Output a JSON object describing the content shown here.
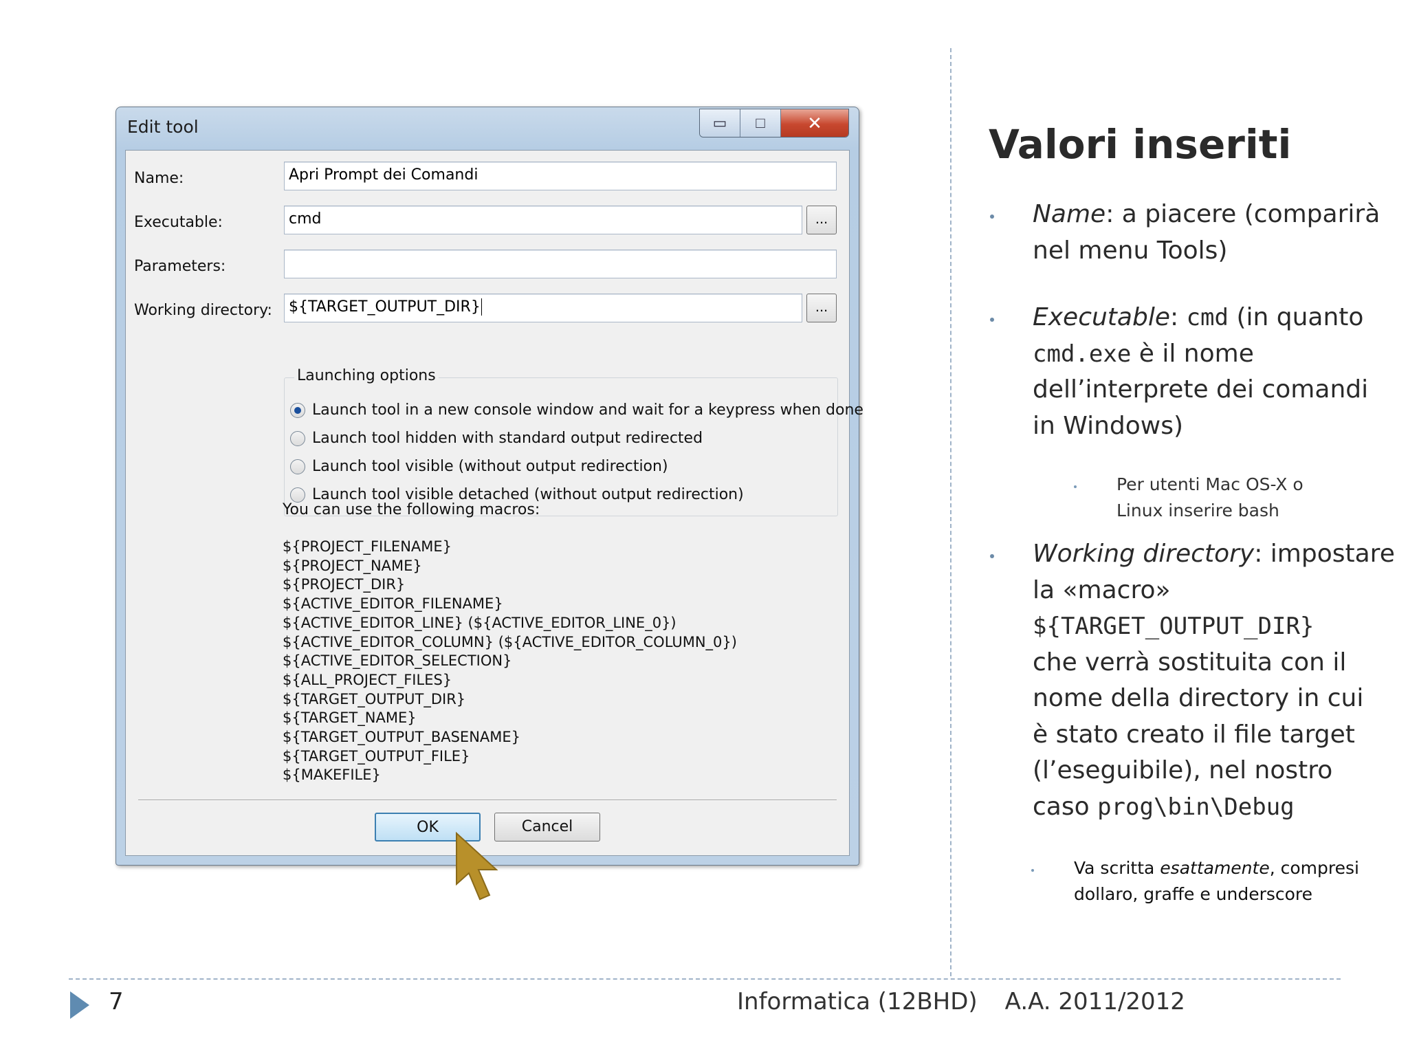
{
  "dialog": {
    "title": "Edit tool",
    "window_buttons": {
      "minimize": "▭",
      "maximize": "□",
      "close": "✕"
    },
    "fields": {
      "name_label": "Name:",
      "name_value": "Apri Prompt dei Comandi",
      "executable_label": "Executable:",
      "executable_value": "cmd",
      "parameters_label": "Parameters:",
      "parameters_value": "",
      "working_dir_label": "Working directory:",
      "working_dir_value": "${TARGET_OUTPUT_DIR}",
      "browse_label": "..."
    },
    "launching_options": {
      "legend": "Launching options",
      "options": [
        "Launch tool in a new console window and wait for a keypress when done",
        "Launch tool hidden with standard output redirected",
        "Launch tool visible (without output redirection)",
        "Launch tool visible detached (without output redirection)"
      ],
      "selected_index": 0
    },
    "macros_heading": "You can use the following macros:",
    "macros": [
      "${PROJECT_FILENAME}",
      "${PROJECT_NAME}",
      "${PROJECT_DIR}",
      "${ACTIVE_EDITOR_FILENAME}",
      "${ACTIVE_EDITOR_LINE} (${ACTIVE_EDITOR_LINE_0})",
      "${ACTIVE_EDITOR_COLUMN} (${ACTIVE_EDITOR_COLUMN_0})",
      "${ACTIVE_EDITOR_SELECTION}",
      "${ALL_PROJECT_FILES}",
      "${TARGET_OUTPUT_DIR}",
      "${TARGET_NAME}",
      "${TARGET_OUTPUT_BASENAME}",
      "${TARGET_OUTPUT_FILE}",
      "${MAKEFILE}"
    ],
    "ok_label": "OK",
    "cancel_label": "Cancel"
  },
  "slide": {
    "heading": "Valori inseriti",
    "bullets": {
      "name_term": "Name",
      "name_line1_rest": ": a piacere (comparirà",
      "name_line2": "nel menu Tools)",
      "exe_term": "Executable",
      "exe_line1_sep": ": ",
      "exe_code1": "cmd",
      "exe_line1_rest": " (in quanto",
      "exe_code2": "cmd.exe",
      "exe_line2_rest": " è il nome",
      "exe_line3": "dell’interprete dei comandi",
      "exe_line4": "in Windows)",
      "wd_term": "Working directory",
      "wd_line1_rest": ": impostare",
      "wd_line2": "la «macro»",
      "wd_code": "${TARGET_OUTPUT_DIR}",
      "wd_line4": "che verrà sostituita con il",
      "wd_line5": "nome della directory in cui",
      "wd_line6": "è stato creato il file target",
      "wd_line7": "(l’eseguibile), nel nostro",
      "wd_line8_pre": "caso ",
      "wd_line8_code": "prog\\bin\\Debug"
    },
    "sub_mac": {
      "line1": "Per utenti Mac OS-X o",
      "line2": "Linux inserire bash"
    },
    "sub_exact": {
      "line1_pre": "Va scritta ",
      "line1_em": "esattamente",
      "line1_post": ", compresi",
      "line2": "dollaro, graffe e underscore"
    }
  },
  "footer": {
    "page_number": "7",
    "course": "Informatica (12BHD)",
    "year": "A.A. 2011/2012"
  }
}
